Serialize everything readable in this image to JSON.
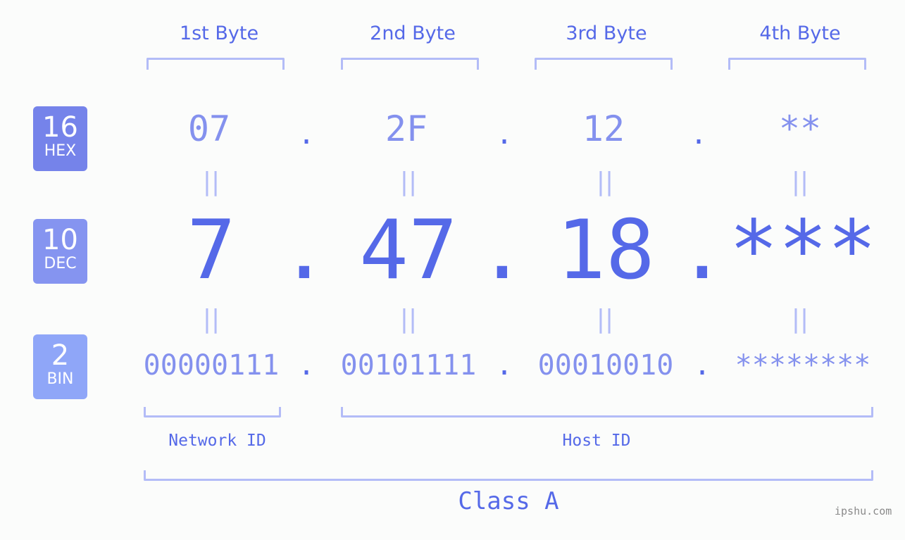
{
  "bytes": [
    {
      "label": "1st Byte",
      "hex": "07",
      "dec": "7",
      "bin": "00000111"
    },
    {
      "label": "2nd Byte",
      "hex": "2F",
      "dec": "47",
      "bin": "00101111"
    },
    {
      "label": "3rd Byte",
      "hex": "12",
      "dec": "18",
      "bin": "00010010"
    },
    {
      "label": "4th Byte",
      "hex": "**",
      "dec": "***",
      "bin": "********"
    }
  ],
  "badges": {
    "hex": {
      "number": "16",
      "label": "HEX",
      "color": "#7583ea"
    },
    "dec": {
      "number": "10",
      "label": "DEC",
      "color": "#8594f0"
    },
    "bin": {
      "number": "2",
      "label": "BIN",
      "color": "#8fa6f8"
    }
  },
  "separator": ".",
  "equals": "||",
  "network_id_label": "Network ID",
  "host_id_label": "Host ID",
  "class_label": "Class A",
  "watermark": "ipshu.com",
  "colors": {
    "accent": "#5569e8",
    "light": "#8491ee",
    "bracket": "#b3bcf7"
  }
}
